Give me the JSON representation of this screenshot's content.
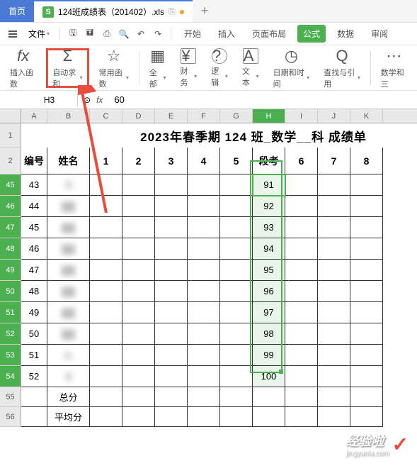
{
  "tabs": {
    "home": "首页",
    "file": "124班成绩表（201402）.xls",
    "close": "×",
    "copy_icon": "⎘",
    "new": "+"
  },
  "menu": {
    "file": "文件",
    "arrow": "▾",
    "start": "开始",
    "insert": "插入",
    "pagelayout": "页面布局",
    "formula": "公式",
    "data": "数据",
    "review": "审阅"
  },
  "ribbon": {
    "insert_fn": {
      "icon": "fx",
      "label": "插入函数"
    },
    "autosum": {
      "icon": "Σ",
      "label": "自动求和"
    },
    "common_fn": {
      "icon": "☆",
      "label": "常用函数"
    },
    "all": {
      "icon": "▦",
      "label": "全部"
    },
    "finance": {
      "icon": "¥",
      "label": "财务"
    },
    "logic": {
      "icon": "?",
      "label": "逻辑"
    },
    "text": {
      "icon": "A",
      "label": "文本"
    },
    "datetime": {
      "icon": "◷",
      "label": "日期和时间"
    },
    "lookup": {
      "icon": "Q",
      "label": "查找与引用"
    },
    "math": {
      "label": "数学和三"
    }
  },
  "formula_bar": {
    "name_box": "H3",
    "fx": "fx",
    "value": "60"
  },
  "columns": [
    "A",
    "B",
    "C",
    "D",
    "E",
    "F",
    "G",
    "H",
    "I",
    "J",
    "K"
  ],
  "title": "2023年春季期 124 班_数学__科 成绩单",
  "headers": {
    "id": "编号",
    "name": "姓名",
    "c1": "1",
    "c2": "2",
    "c3": "3",
    "c4": "4",
    "c5": "5",
    "exam": "段考",
    "c6": "6",
    "c7": "7",
    "c8": "8"
  },
  "footer": {
    "total": "总分",
    "avg": "平均分"
  },
  "rows": [
    {
      "rh": "1"
    },
    {
      "rh": "2"
    },
    {
      "rh": "45",
      "id": "43",
      "name": "领",
      "exam": "91"
    },
    {
      "rh": "46",
      "id": "44",
      "name": "",
      "exam": "92"
    },
    {
      "rh": "47",
      "id": "45",
      "name": "",
      "exam": "93"
    },
    {
      "rh": "48",
      "id": "46",
      "name": "",
      "exam": "94"
    },
    {
      "rh": "49",
      "id": "47",
      "name": "",
      "exam": "95"
    },
    {
      "rh": "50",
      "id": "48",
      "name": "",
      "exam": "96"
    },
    {
      "rh": "51",
      "id": "49",
      "name": "",
      "exam": "97"
    },
    {
      "rh": "52",
      "id": "50",
      "name": "",
      "exam": "98"
    },
    {
      "rh": "53",
      "id": "51",
      "name": "赵",
      "exam": "99"
    },
    {
      "rh": "54",
      "id": "52",
      "name": "谢",
      "exam": "100"
    },
    {
      "rh": "55"
    },
    {
      "rh": "56"
    }
  ],
  "watermark": {
    "text": "经验啦",
    "sub": "jingyanla.com",
    "check": "✓"
  }
}
